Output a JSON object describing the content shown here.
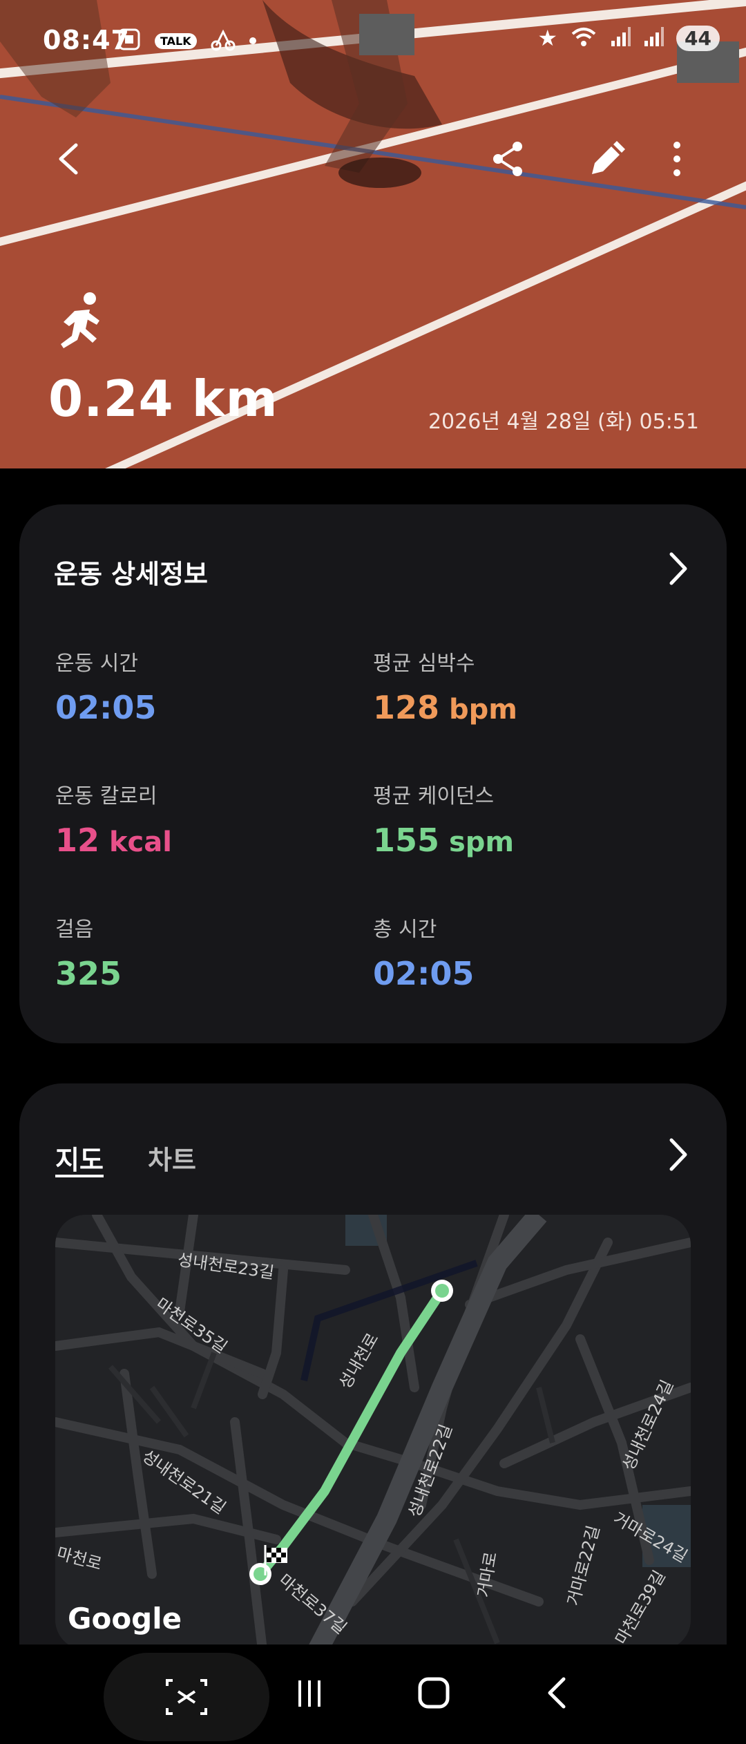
{
  "status_bar": {
    "time": "08:47",
    "battery": "44",
    "talk_label": "TALK",
    "icons": [
      "screenshot-icon",
      "kakaotalk-icon",
      "delivery-icon",
      "dot-icon",
      "star-icon",
      "wifi-icon",
      "signal-icon",
      "signal-icon",
      "battery-icon"
    ]
  },
  "hero": {
    "distance": "0.24 km",
    "date": "2026년 4월 28일 (화) 05:51"
  },
  "details": {
    "title": "운동 상세정보",
    "metrics": [
      {
        "label": "운동 시간",
        "value": "02:05",
        "unit": "",
        "color": "#6f9cf0"
      },
      {
        "label": "평균 심박수",
        "value": "128",
        "unit": " bpm",
        "color": "#f09a5a"
      },
      {
        "label": "운동 칼로리",
        "value": "12",
        "unit": " kcal",
        "color": "#e8508a"
      },
      {
        "label": "평균 케이던스",
        "value": "155",
        "unit": " spm",
        "color": "#7ad48f"
      },
      {
        "label": "걸음",
        "value": "325",
        "unit": "",
        "color": "#7ad48f"
      },
      {
        "label": "총 시간",
        "value": "02:05",
        "unit": "",
        "color": "#6f9cf0"
      }
    ]
  },
  "map_card": {
    "tabs": [
      "지도",
      "차트"
    ],
    "selected_tab": "지도",
    "google_label": "Google",
    "street_labels": [
      "성내천로23길",
      "마천로35길",
      "성내천로",
      "성내천로21길",
      "성내천로22길",
      "마천로",
      "거마로",
      "거마로22길",
      "성내천로24길",
      "거마로24길",
      "마천로39길",
      "마천로37길"
    ],
    "route_color": "#7ad48f"
  }
}
